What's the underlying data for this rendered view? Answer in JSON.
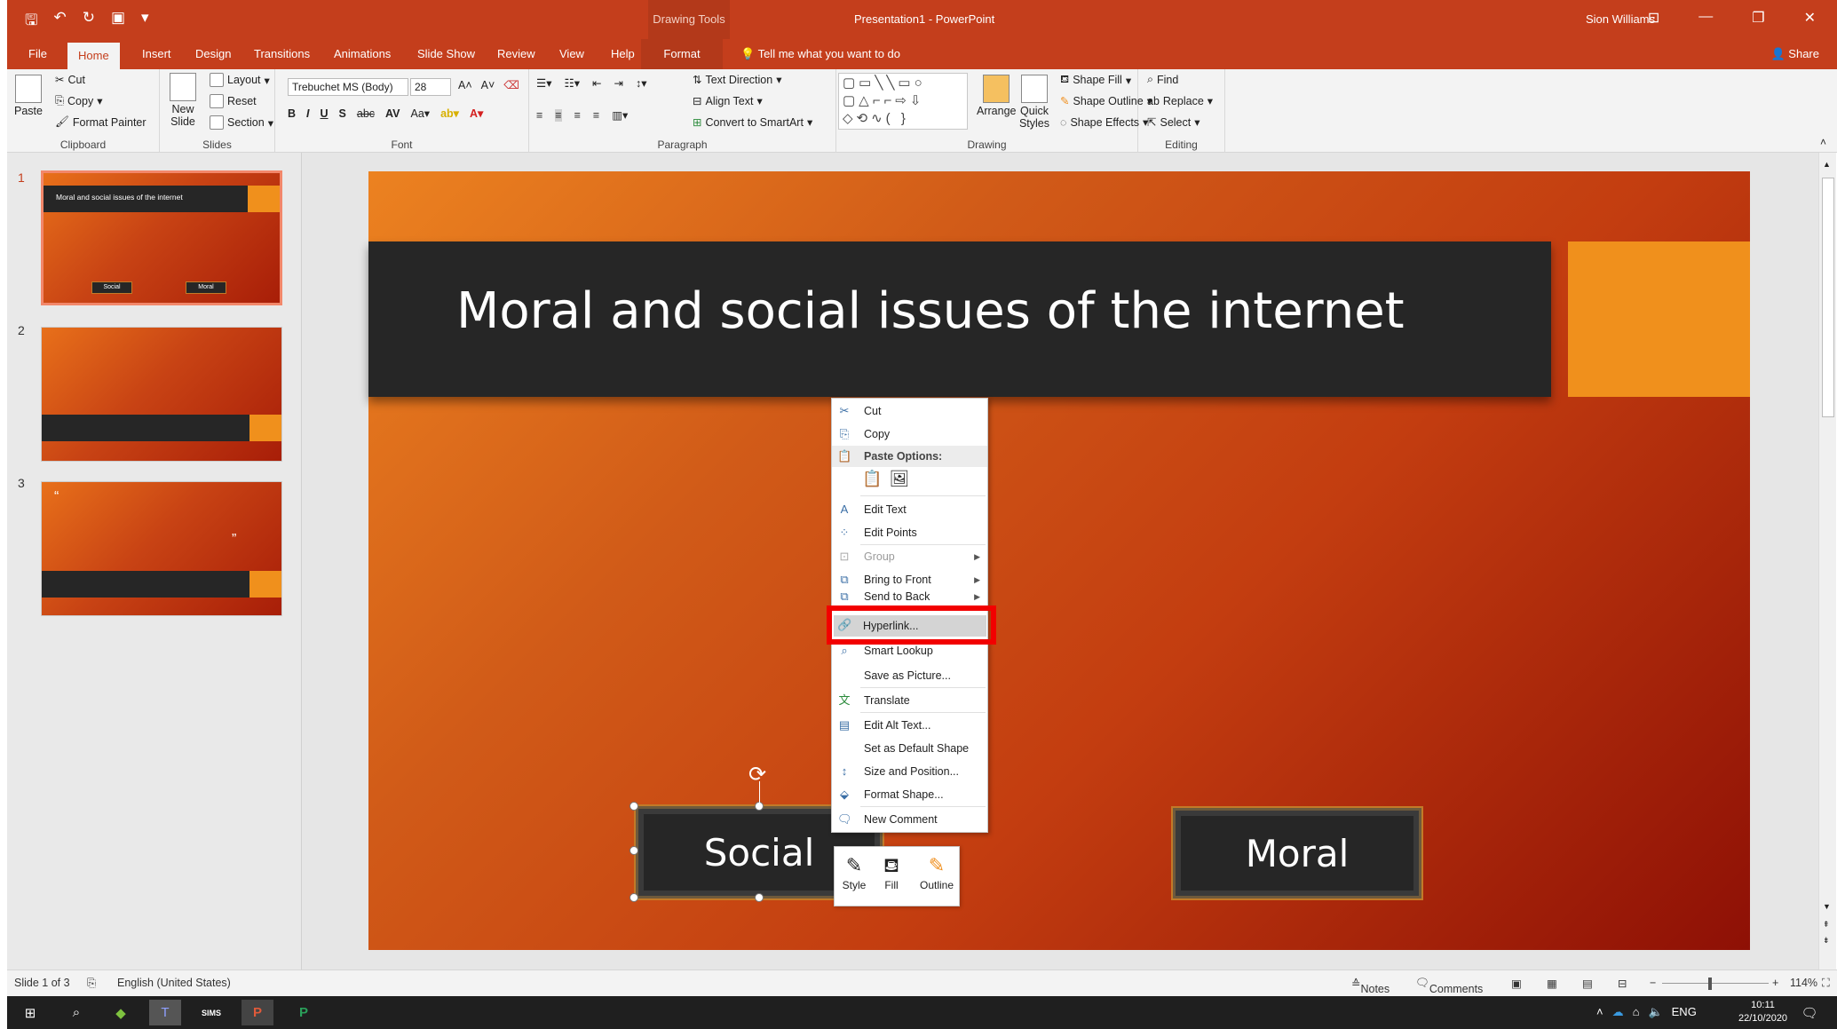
{
  "titlebar": {
    "drawing_tools": "Drawing Tools",
    "title": "Presentation1  -  PowerPoint",
    "user": "Sion Williams"
  },
  "tabs": [
    "File",
    "Home",
    "Insert",
    "Design",
    "Transitions",
    "Animations",
    "Slide Show",
    "Review",
    "View",
    "Help",
    "Format"
  ],
  "tellme": "Tell me what you want to do",
  "share": "Share",
  "ribbon": {
    "clipboard": {
      "paste": "Paste",
      "cut": "Cut",
      "copy": "Copy",
      "format_painter": "Format Painter",
      "label": "Clipboard"
    },
    "slides": {
      "new_slide": "New Slide",
      "layout": "Layout",
      "reset": "Reset",
      "section": "Section",
      "label": "Slides"
    },
    "font": {
      "family": "Trebuchet MS (Body)",
      "size": "28",
      "label": "Font"
    },
    "paragraph": {
      "text_direction": "Text Direction",
      "align_text": "Align Text",
      "convert_smartart": "Convert to SmartArt",
      "label": "Paragraph"
    },
    "drawing": {
      "arrange": "Arrange",
      "quick_styles": "Quick Styles",
      "shape_fill": "Shape Fill",
      "shape_outline": "Shape Outline",
      "shape_effects": "Shape Effects",
      "label": "Drawing"
    },
    "editing": {
      "find": "Find",
      "replace": "Replace",
      "select": "Select",
      "label": "Editing"
    }
  },
  "thumbnails": [
    {
      "num": "1",
      "title": "Moral and social issues of the internet",
      "btn1": "Social",
      "btn2": "Moral"
    },
    {
      "num": "2"
    },
    {
      "num": "3",
      "quote_open": "“",
      "quote_close": "”"
    }
  ],
  "slide": {
    "title": "Moral and social issues of the internet",
    "button_social": "Social",
    "button_moral": "Moral"
  },
  "context_menu": {
    "cut": "Cut",
    "copy": "Copy",
    "paste_options": "Paste Options:",
    "edit_text": "Edit Text",
    "edit_points": "Edit Points",
    "group": "Group",
    "bring_to_front": "Bring to Front",
    "send_to_back": "Send to Back",
    "hyperlink": "Hyperlink...",
    "smart_lookup": "Smart Lookup",
    "save_as_picture": "Save as Picture...",
    "translate": "Translate",
    "edit_alt_text": "Edit Alt Text...",
    "set_default_shape": "Set as Default Shape",
    "size_position": "Size and Position...",
    "format_shape": "Format Shape...",
    "new_comment": "New Comment"
  },
  "mini_toolbar": {
    "style": "Style",
    "fill": "Fill",
    "outline": "Outline"
  },
  "status": {
    "slide": "Slide 1 of 3",
    "language": "English (United States)",
    "notes": "Notes",
    "comments": "Comments",
    "zoom": "114%"
  },
  "taskbar": {
    "lang": "ENG",
    "time": "10:11",
    "date": "22/10/2020"
  }
}
